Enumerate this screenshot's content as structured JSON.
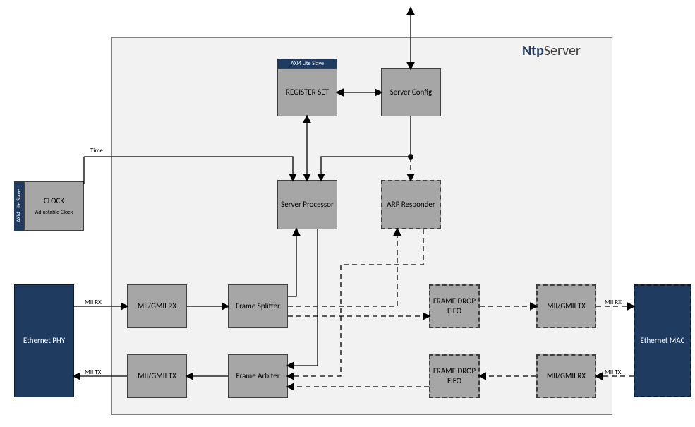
{
  "title": {
    "bold": "Ntp",
    "rest": "Server"
  },
  "blocks": {
    "clock": {
      "name": "CLOCK",
      "sub": "Adjustable Clock"
    },
    "clock_tab": "AXI4 Lite Slave",
    "reg_tab": "AXI4 Lite Slave",
    "register_set": "REGISTER SET",
    "server_config": "Server Config",
    "server_processor": "Server Processor",
    "arp_responder": "ARP Responder",
    "mii_rx": "MII/GMII RX",
    "frame_splitter": "Frame Splitter",
    "frame_drop_fifo_top": "FRAME DROP FIFO",
    "mii_tx_r": "MII/GMII TX",
    "mii_tx_l": "MII/GMII TX",
    "frame_arbiter": "Frame Arbiter",
    "frame_drop_fifo_bot": "FRAME DROP FIFO",
    "mii_rx_r": "MII/GMII RX",
    "eth_phy": "Ethernet PHY",
    "eth_mac": "Ethernet MAC"
  },
  "labels": {
    "time": "Time",
    "mii_rx_l": "MII RX",
    "mii_tx_l": "MII TX",
    "mii_rx_r": "MII RX",
    "mii_tx_r": "MII TX"
  },
  "chart_data": {
    "type": "diagram",
    "title": "NtpServer block diagram",
    "nodes": [
      {
        "id": "clock",
        "label": "CLOCK",
        "sub": "Adjustable Clock",
        "style": "gray",
        "tab": "AXI4 Lite Slave"
      },
      {
        "id": "eth_phy",
        "label": "Ethernet PHY",
        "style": "navy"
      },
      {
        "id": "eth_mac",
        "label": "Ethernet MAC",
        "style": "navy-dashed"
      },
      {
        "id": "register_set",
        "label": "REGISTER SET",
        "style": "gray",
        "tab": "AXI4 Lite Slave"
      },
      {
        "id": "server_config",
        "label": "Server Config",
        "style": "gray"
      },
      {
        "id": "server_processor",
        "label": "Server Processor",
        "style": "gray"
      },
      {
        "id": "arp_responder",
        "label": "ARP Responder",
        "style": "gray-dashed"
      },
      {
        "id": "mii_rx_l",
        "label": "MII/GMII RX",
        "style": "gray"
      },
      {
        "id": "frame_splitter",
        "label": "Frame Splitter",
        "style": "gray"
      },
      {
        "id": "frame_drop_fifo_top",
        "label": "FRAME DROP FIFO",
        "style": "gray-dashed"
      },
      {
        "id": "mii_tx_r",
        "label": "MII/GMII TX",
        "style": "gray-dashed"
      },
      {
        "id": "mii_tx_l",
        "label": "MII/GMII TX",
        "style": "gray"
      },
      {
        "id": "frame_arbiter",
        "label": "Frame Arbiter",
        "style": "gray"
      },
      {
        "id": "frame_drop_fifo_bot",
        "label": "FRAME DROP FIFO",
        "style": "gray-dashed"
      },
      {
        "id": "mii_rx_r",
        "label": "MII/GMII RX",
        "style": "gray-dashed"
      }
    ],
    "edges": [
      {
        "from": "ext_top",
        "to": "server_config",
        "style": "solid",
        "dir": "both"
      },
      {
        "from": "register_set",
        "to": "server_config",
        "style": "solid",
        "dir": "both"
      },
      {
        "from": "register_set",
        "to": "server_processor",
        "style": "solid",
        "dir": "both"
      },
      {
        "from": "server_config",
        "to": "server_processor",
        "style": "solid",
        "dir": "fwd"
      },
      {
        "from": "server_config",
        "to": "arp_responder",
        "style": "dashed",
        "dir": "fwd"
      },
      {
        "from": "clock",
        "to": "server_processor",
        "label": "Time",
        "style": "solid",
        "dir": "fwd"
      },
      {
        "from": "eth_phy",
        "to": "mii_rx_l",
        "label": "MII RX",
        "style": "solid",
        "dir": "fwd"
      },
      {
        "from": "mii_rx_l",
        "to": "frame_splitter",
        "style": "solid",
        "dir": "fwd"
      },
      {
        "from": "frame_splitter",
        "to": "server_processor",
        "style": "solid",
        "dir": "fwd"
      },
      {
        "from": "frame_splitter",
        "to": "arp_responder",
        "style": "dashed",
        "dir": "fwd"
      },
      {
        "from": "frame_splitter",
        "to": "frame_drop_fifo_top",
        "style": "dashed",
        "dir": "fwd"
      },
      {
        "from": "frame_drop_fifo_top",
        "to": "mii_tx_r",
        "style": "dashed",
        "dir": "fwd"
      },
      {
        "from": "mii_tx_r",
        "to": "eth_mac",
        "label": "MII RX",
        "style": "dashed",
        "dir": "fwd"
      },
      {
        "from": "server_processor",
        "to": "frame_arbiter",
        "style": "solid",
        "dir": "fwd"
      },
      {
        "from": "arp_responder",
        "to": "frame_arbiter",
        "style": "dashed",
        "dir": "fwd"
      },
      {
        "from": "frame_arbiter",
        "to": "mii_tx_l",
        "style": "solid",
        "dir": "fwd"
      },
      {
        "from": "mii_tx_l",
        "to": "eth_phy",
        "label": "MII TX",
        "style": "solid",
        "dir": "fwd"
      },
      {
        "from": "eth_mac",
        "to": "mii_rx_r",
        "label": "MII TX",
        "style": "dashed",
        "dir": "fwd"
      },
      {
        "from": "mii_rx_r",
        "to": "frame_drop_fifo_bot",
        "style": "dashed",
        "dir": "fwd"
      },
      {
        "from": "frame_drop_fifo_bot",
        "to": "frame_arbiter",
        "style": "dashed",
        "dir": "fwd"
      }
    ]
  }
}
